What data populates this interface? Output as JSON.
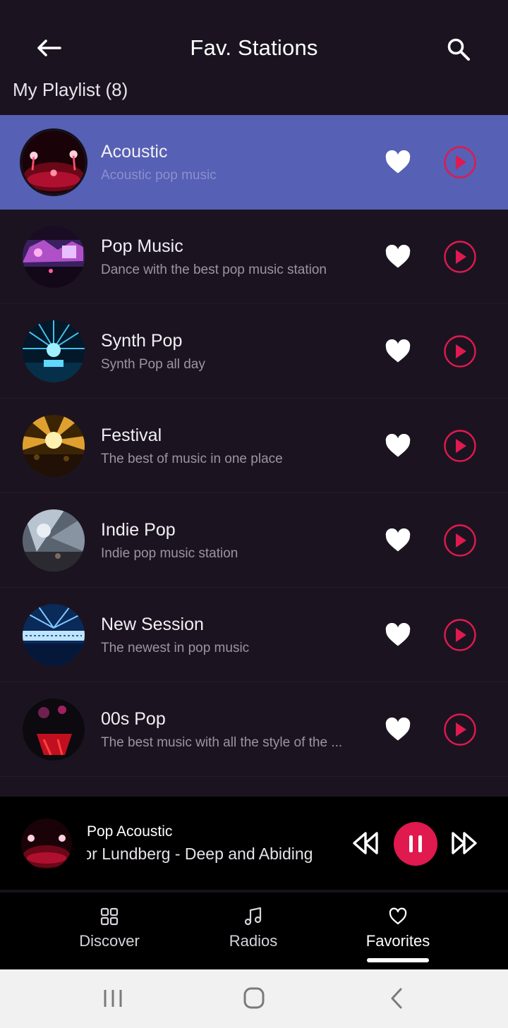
{
  "header": {
    "title": "Fav. Stations",
    "back_icon": "arrow-left-icon",
    "search_icon": "search-icon"
  },
  "section_label": "My Playlist (8)",
  "colors": {
    "background": "#1b1420",
    "active_row": "#5660b4",
    "accent": "#e0194f",
    "heart": "#ffffff"
  },
  "stations": [
    {
      "name": "Acoustic",
      "description": "Acoustic pop music",
      "active": true,
      "favorite": true
    },
    {
      "name": "Pop Music",
      "description": "Dance with the best pop music station",
      "active": false,
      "favorite": true
    },
    {
      "name": "Synth Pop",
      "description": "Synth Pop all day",
      "active": false,
      "favorite": true
    },
    {
      "name": "Festival",
      "description": "The best of music in one place",
      "active": false,
      "favorite": true
    },
    {
      "name": "Indie Pop",
      "description": "Indie pop music station",
      "active": false,
      "favorite": true
    },
    {
      "name": "New Session",
      "description": "The newest in pop music",
      "active": false,
      "favorite": true
    },
    {
      "name": "00s Pop",
      "description": "The best music with all the style of the ...",
      "active": false,
      "favorite": true
    }
  ],
  "player": {
    "station": "Pop Acoustic",
    "track": "tor Lundberg - Deep and Abiding",
    "state": "playing"
  },
  "bottom_nav": {
    "items": [
      {
        "label": "Discover",
        "icon": "grid-icon",
        "selected": false
      },
      {
        "label": "Radios",
        "icon": "music-note-icon",
        "selected": false
      },
      {
        "label": "Favorites",
        "icon": "heart-outline-icon",
        "selected": true
      }
    ]
  }
}
